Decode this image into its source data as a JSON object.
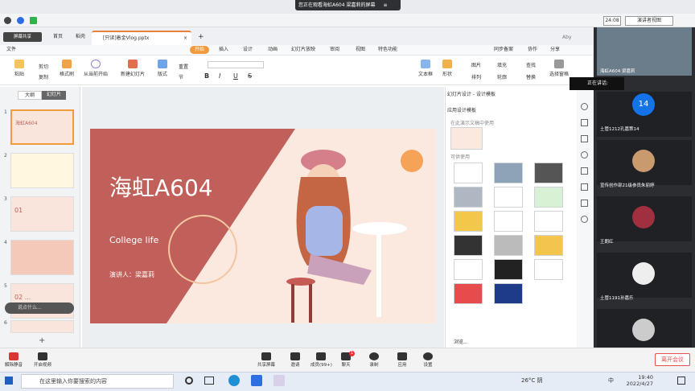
{
  "meeting": {
    "banner": "您正在观看海虹A604 梁嘉莉的屏幕",
    "time": "24:08",
    "view_label": "演讲者视图"
  },
  "wps": {
    "tabs": [
      "首页",
      "稻壳",
      "[只读]着金Vlog.pptx"
    ],
    "user": "Aby",
    "menu": [
      "文件",
      "开始",
      "插入",
      "设计",
      "动画",
      "幻灯片放映",
      "审阅",
      "视图",
      "特色功能"
    ],
    "menu_right": [
      "同步备案",
      "协作",
      "分享"
    ],
    "ribbon": [
      "剪切",
      "复制",
      "粘贴",
      "格式刷",
      "从当前开始",
      "新建幻灯片",
      "版式",
      "重置",
      "节",
      "文本框",
      "形状",
      "图片",
      "排列",
      "填充",
      "轮廓",
      "查找",
      "替换",
      "选择窗格"
    ],
    "font_buttons": [
      "B",
      "I",
      "U",
      "S"
    ],
    "share_tooltip": "屏幕共享"
  },
  "left_pane": {
    "tab_outline": "大纲",
    "tab_slides": "幻灯片",
    "slide_numbers": [
      "1",
      "2",
      "3",
      "4",
      "5",
      "6"
    ],
    "thumb_texts": [
      "海虹A604",
      "",
      "01",
      "",
      "02 ...",
      ""
    ],
    "chat_placeholder": "说点什么...",
    "add": "+"
  },
  "slide": {
    "title": "海虹A604",
    "subtitle": "College life",
    "presenter": "演讲人：梁嘉莉"
  },
  "right_panel": {
    "title": "幻灯片设计 - 设计模板",
    "section1": "应用设计模板",
    "section2": "在此演示文稿中使用",
    "section3": "可供使用",
    "browse": "浏览..."
  },
  "participants": {
    "speaking_label": "正在讲话:",
    "list": [
      {
        "name": "海虹A604 梁嘉莉",
        "avatar": "video"
      },
      {
        "name": "土管1212孔嘉策14",
        "avatar": "14"
      },
      {
        "name": "宣传创作部21级参员朱丽婷",
        "avatar": "photo"
      },
      {
        "name": "王朗红",
        "avatar": "photo"
      },
      {
        "name": "土管1191孙嘉乐",
        "avatar": "photo"
      },
      {
        "name": "",
        "avatar": "photo"
      }
    ]
  },
  "controls": {
    "mute": "解除静音",
    "video": "开启视频",
    "share": "共享屏幕",
    "invite": "邀请",
    "members": "成员(99+)",
    "chat": "聊天",
    "chat_badge": "1",
    "record": "录制",
    "apps": "应用",
    "settings": "设置",
    "leave": "离开会议"
  },
  "taskbar": {
    "search_placeholder": "在这里输入你要搜索的内容",
    "weather": "26°C 阴",
    "ime": "中",
    "time": "19:40",
    "date": "2022/4/27"
  },
  "colors": {
    "accent": "#f29b3c",
    "slide_red": "#c1605a",
    "slide_bg": "#fbe8df",
    "leave": "#e94f4f"
  }
}
